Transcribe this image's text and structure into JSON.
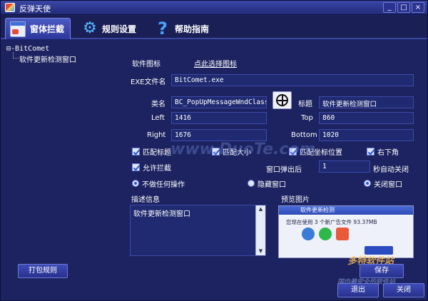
{
  "window": {
    "title": "反弹天使",
    "controls": [
      "_",
      "□",
      "×"
    ]
  },
  "tabs": [
    {
      "label": "窗体拦截",
      "icon": "window-icon",
      "active": true
    },
    {
      "label": "规则设置",
      "icon": "gear-icon",
      "active": false
    },
    {
      "label": "帮助指南",
      "icon": "help-icon",
      "active": false
    }
  ],
  "tree": {
    "root": "BitComet",
    "child": "软件更新检测窗口"
  },
  "form": {
    "software_icon_label": "软件图标",
    "select_icon_link": "点此选择图标",
    "exe_label": "EXE文件名",
    "exe_value": "BitComet.exe",
    "class_label": "类名",
    "class_value": "BC_PopUpMessageWndClass",
    "title_label": "标题",
    "title_value": "软件更新检测窗口",
    "left_label": "Left",
    "left_value": "1416",
    "top_label": "Top",
    "top_value": "860",
    "right_label": "Right",
    "right_value": "1676",
    "bottom_label": "Bottom",
    "bottom_value": "1020"
  },
  "options": {
    "match_title": "匹配标题",
    "match_size": "匹配大小",
    "match_coords": "匹配坐标位置",
    "bottom_right": "右下角",
    "allow_block": "允许拦截",
    "popup_after_label": "窗口弹出后",
    "popup_after_value": "1",
    "auto_close_suffix": "秒自动关闭"
  },
  "actions": {
    "none": "不做任何操作",
    "hide": "隐藏窗口",
    "close": "关闭窗口"
  },
  "description": {
    "label": "描述信息",
    "value": "软件更新检测窗口"
  },
  "preview": {
    "label": "预览图片",
    "window_title": "软件更新检测",
    "text": "您现在使用 3 个新广告文件 93.37MB"
  },
  "buttons": {
    "pack_rules": "打包规则",
    "save": "保存",
    "exit": "退出",
    "close": "关闭"
  },
  "watermarks": {
    "site": "www.DuoTe.com",
    "brand": "多特软件站",
    "tagline": "国内最安全的软件站"
  },
  "colors": {
    "background": "#1c2360",
    "accent": "#3e4aa8"
  }
}
